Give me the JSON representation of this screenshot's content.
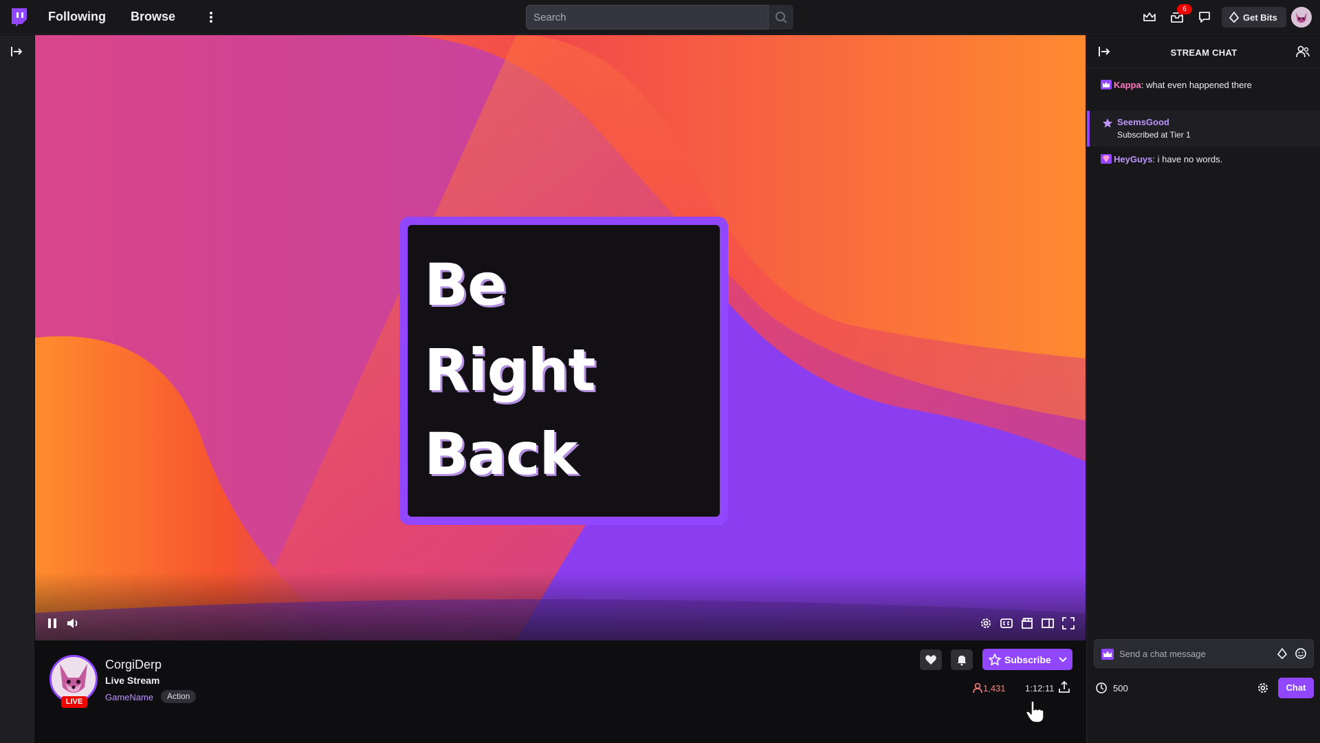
{
  "topbar": {
    "nav": {
      "following": "Following",
      "browse": "Browse"
    },
    "search": {
      "placeholder": "Search"
    },
    "notification_count": "6",
    "get_bits_label": "Get Bits"
  },
  "video": {
    "overlay_lines": [
      "Be",
      "Right",
      "Back"
    ]
  },
  "channel": {
    "name": "CorgiDerp",
    "title": "Live Stream",
    "game": "GameName",
    "tag": "Action",
    "live_label": "LIVE",
    "viewer_count": "1,431",
    "uptime": "1:12:11",
    "subscribe_label": "Subscribe"
  },
  "chat": {
    "header_title": "STREAM CHAT",
    "messages": [
      {
        "user": "Kappa",
        "user_color": "#ff7ac0",
        "text": ": what even happened there",
        "badge": "crown-badge-icon"
      },
      {
        "user": "HeyGuys",
        "user_color": "#bf94ff",
        "text": ": i have no words.",
        "badge": "gem-badge-icon"
      }
    ],
    "subscription": {
      "user": "SeemsGood",
      "text": "Subscribed at Tier 1"
    },
    "input_placeholder": "Send a chat message",
    "points": "500",
    "send_label": "Chat"
  },
  "colors": {
    "accent": "#9147ff",
    "live": "#eb0400",
    "background": "#0e0e10",
    "panel": "#18181b"
  }
}
